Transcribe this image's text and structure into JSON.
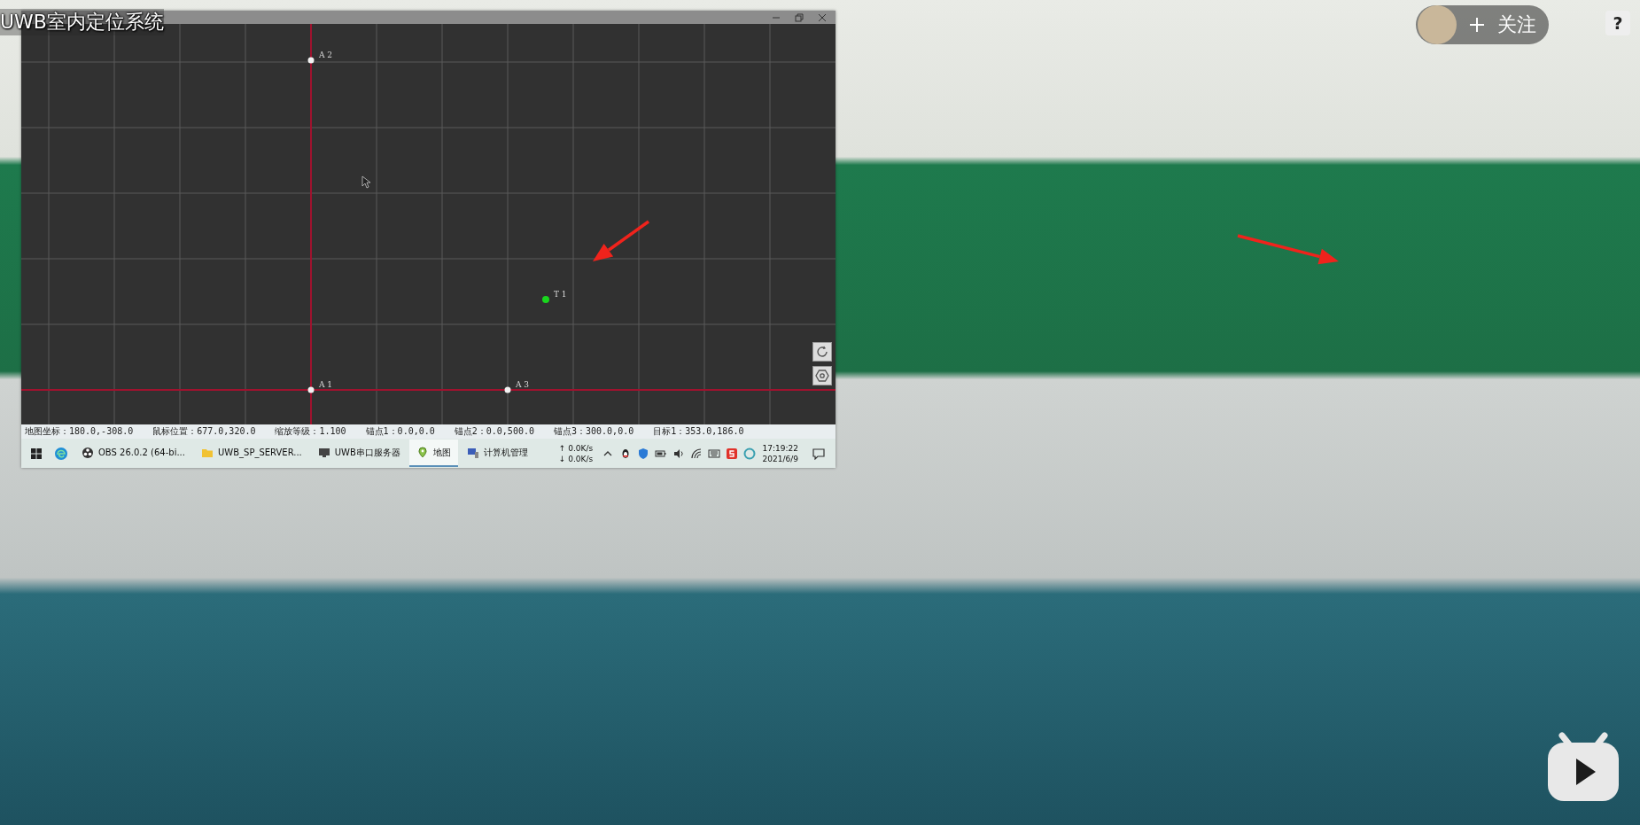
{
  "video": {
    "caption": "UWB室内定位系统"
  },
  "app": {
    "map": {
      "nodes": [
        {
          "label": "A 2",
          "kind": "anchor"
        },
        {
          "label": "T 1",
          "kind": "tag"
        },
        {
          "label": "A 1",
          "kind": "anchor"
        },
        {
          "label": "A 3",
          "kind": "anchor"
        }
      ]
    },
    "status_bar": [
      "地图坐标：180.0,-308.0",
      "鼠标位置：677.0,320.0",
      "缩放等级：1.100",
      "锚点1：0.0,0.0",
      "锚点2：0.0,500.0",
      "锚点3：300.0,0.0",
      "目标1：353.0,186.0"
    ],
    "taskbar": {
      "items": [
        {
          "label": "OBS 26.0.2 (64-bi...",
          "kind": "obs",
          "selected": false
        },
        {
          "label": "UWB_SP_SERVER...",
          "kind": "folder",
          "selected": false
        },
        {
          "label": "UWB串口服务器",
          "kind": "monitor",
          "selected": false
        },
        {
          "label": "地图",
          "kind": "map",
          "selected": true
        },
        {
          "label": "计算机管理",
          "kind": "computer",
          "selected": false
        }
      ],
      "net_up": "↑ 0.0K/s",
      "net_down": "↓ 0.0K/s",
      "time": "17:19:22",
      "date": "2021/6/9"
    }
  },
  "player": {
    "follow_button": "关注",
    "help": "?"
  }
}
